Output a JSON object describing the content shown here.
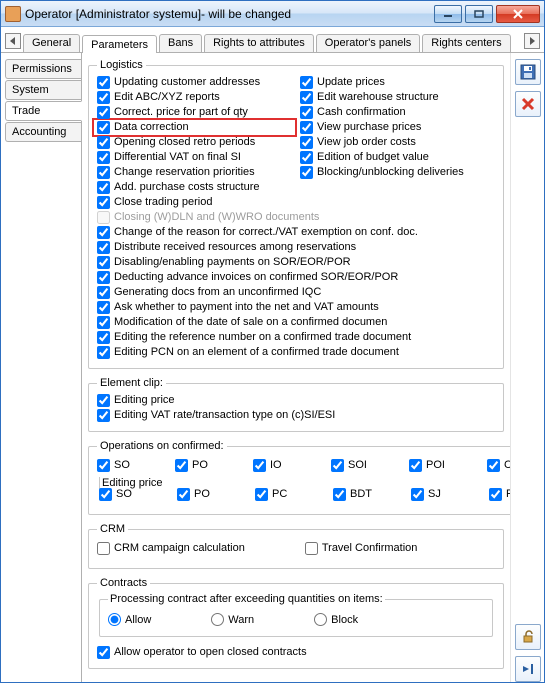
{
  "window_title": "Operator [Administrator systemu]- will be changed",
  "tabs": [
    "General",
    "Parameters",
    "Bans",
    "Rights to attributes",
    "Operator's panels",
    "Rights centers"
  ],
  "active_tab": 1,
  "sidetabs": [
    "Permissions",
    "System",
    "Trade",
    "Accounting"
  ],
  "active_sidetab": 2,
  "group_logistics": "Logistics",
  "logistics_left": [
    "Updating customer addresses",
    "Edit ABC/XYZ reports",
    "Correct. price for part of qty",
    "Data correction",
    "Opening closed retro periods",
    "Differential VAT on final SI",
    "Change reservation priorities"
  ],
  "logistics_right": [
    "Update prices",
    "Edit warehouse structure",
    "Cash confirmation",
    "View purchase prices",
    "View job order costs",
    "Edition of budget value",
    "Blocking/unblocking deliveries"
  ],
  "logistics_full": [
    "Add. purchase costs structure",
    "Close trading period",
    {
      "label": "Closing (W)DLN and (W)WRO documents",
      "disabled": true,
      "checked": false
    },
    "Change of the reason for correct./VAT exemption on conf. doc.",
    "Distribute received resources among reservations",
    "Disabling/enabling payments on SOR/EOR/POR",
    "Deducting advance invoices on confirmed SOR/EOR/POR",
    "Generating docs from an unconfirmed IQC",
    "Ask whether to payment into the net and VAT amounts",
    "Modification of the date of sale on a confirmed documen",
    "Editing the reference number on a confirmed trade document",
    "Editing PCN on an element of a confirmed trade document"
  ],
  "highlight_item": "Data correction",
  "group_elementclip": "Element clip:",
  "elementclip_items": [
    "Editing price",
    "Editing VAT rate/transaction type on (c)SI/ESI"
  ],
  "group_ops": "Operations on confirmed:",
  "ops_row1": [
    "SO",
    "PO",
    "IO",
    "SOI",
    "POI",
    "C"
  ],
  "ops_sub_legend": "Editing price",
  "ops_row2": [
    "SO",
    "PO",
    "PC",
    "BDT",
    "SJ",
    "PKJ"
  ],
  "group_crm": "CRM",
  "crm_items": [
    {
      "label": "CRM campaign calculation",
      "checked": false
    },
    {
      "label": "Travel Confirmation",
      "checked": false
    }
  ],
  "group_contracts": "Contracts",
  "contracts_subgroup": "Processing contract after exceeding quantities on items:",
  "contracts_radios": [
    "Allow",
    "Warn",
    "Block"
  ],
  "contracts_radio_selected": 0,
  "contracts_checkbox": "Allow operator to open closed contracts"
}
